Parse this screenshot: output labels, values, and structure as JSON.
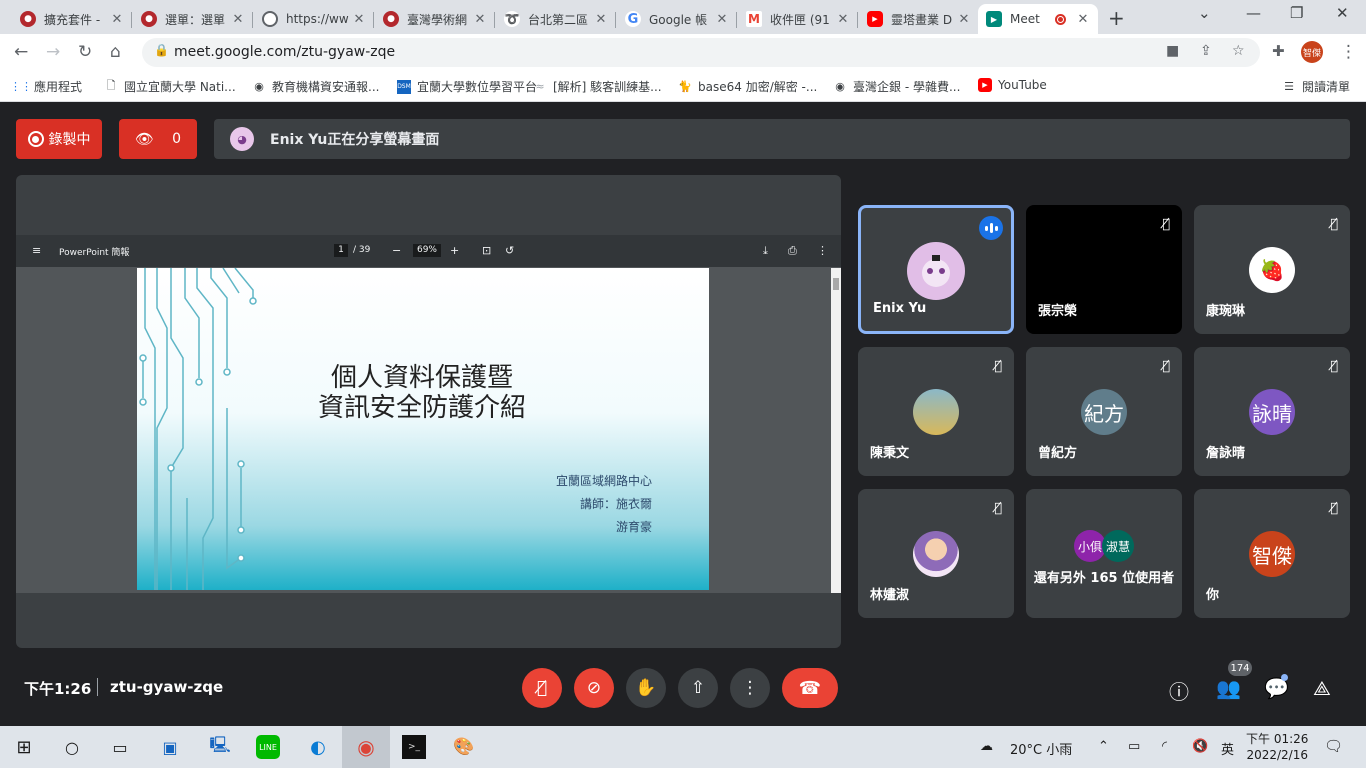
{
  "browser": {
    "tabs": [
      {
        "label": "擴充套件 -",
        "color": "#b3282d"
      },
      {
        "label": "選單：選單",
        "color": "#b3282d"
      },
      {
        "label": "https://ww",
        "color": "#5f6368"
      },
      {
        "label": "臺灣學術網",
        "color": "#b3282d"
      },
      {
        "label": "台北第二區",
        "color": "#1565c0"
      },
      {
        "label": "Google 帳",
        "color": "#4285f4"
      },
      {
        "label": "收件匣 (91",
        "color": "#ea4335"
      },
      {
        "label": "靈塔畫業 D",
        "color": "#ff0000"
      },
      {
        "label": "Meet",
        "color": "#00897b"
      }
    ],
    "url": "meet.google.com/ztu-gyaw-zqe",
    "profile_initials": "智傑"
  },
  "bookmarks": [
    {
      "label": "應用程式",
      "icon": "apps-grid-icon"
    },
    {
      "label": "國立宜蘭大學 Nati...",
      "icon": "page-icon"
    },
    {
      "label": "教育機構資安通報...",
      "icon": "globe-icon"
    },
    {
      "label": "宜蘭大學數位學習平台",
      "icon": "dsm-icon"
    },
    {
      "label": "[解析] 駭客訓練基...",
      "icon": "site-icon"
    },
    {
      "label": "base64 加密/解密 -...",
      "icon": "cat-icon"
    },
    {
      "label": "臺灣企銀 - 學雜費...",
      "icon": "globe-icon"
    },
    {
      "label": "YouTube",
      "icon": "youtube-icon"
    }
  ],
  "reading_list": "閱讀清單",
  "meet": {
    "recording_label": "錄製中",
    "viewer_count": "0",
    "share_banner": "Enix Yu正在分享螢幕畫面",
    "presentation": {
      "app_name": "PowerPoint 簡報",
      "page_current": "1",
      "page_total": "/ 39",
      "zoom": "69%",
      "slide_title_line1": "個人資料保護暨",
      "slide_title_line2": "資訊安全防護介紹",
      "slide_org": "宜蘭區域網路中心",
      "slide_lecturer": "講師：施衣爾",
      "slide_lecturer2": "游育豪"
    },
    "participants": [
      {
        "name": "Enix Yu",
        "avatar": "",
        "avatar_color": "#e1bee7",
        "state": "speaking"
      },
      {
        "name": "張宗榮",
        "avatar": "",
        "avatar_color": "#000000",
        "state": "muted"
      },
      {
        "name": "康琬琳",
        "avatar": "🍓",
        "avatar_color": "#ffffff",
        "state": "muted"
      },
      {
        "name": "陳秉文",
        "avatar": "",
        "avatar_color": "#8bb8c8",
        "state": "muted"
      },
      {
        "name": "曾紀方",
        "avatar": "紀方",
        "avatar_color": "#607d8b",
        "state": "muted"
      },
      {
        "name": "詹詠晴",
        "avatar": "詠晴",
        "avatar_color": "#7e57c2",
        "state": "muted"
      },
      {
        "name": "林嫿淑",
        "avatar": "",
        "avatar_color": "#f3e5f5",
        "state": "muted"
      },
      {
        "name": "還有另外 165 位使用者",
        "avatar": "",
        "avatar_color": "#3c4043",
        "state": "more"
      },
      {
        "name": "你",
        "avatar": "智傑",
        "avatar_color": "#c9431b",
        "state": "muted"
      }
    ],
    "more_avatars": [
      {
        "label": "小俱",
        "color": "#8e24aa"
      },
      {
        "label": "淑慧",
        "color": "#00695c"
      }
    ],
    "time": "下午1:26",
    "meeting_code": "ztu-gyaw-zqe",
    "people_count": "174"
  },
  "taskbar": {
    "weather": "20°C 小雨",
    "ime": "英",
    "clock_time": "下午 01:26",
    "clock_date": "2022/2/16"
  }
}
